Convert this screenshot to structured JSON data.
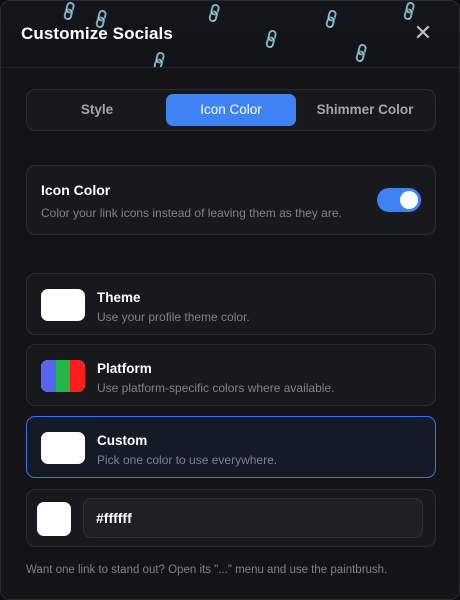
{
  "header": {
    "title": "Customize Socials",
    "close_glyph": "✕"
  },
  "tabs": [
    {
      "label": "Style"
    },
    {
      "label": "Icon Color"
    },
    {
      "label": "Shimmer Color"
    }
  ],
  "active_tab": "Icon Color",
  "icon_color_toggle": {
    "title": "Icon Color",
    "description": "Color your link icons instead of leaving them as they are.",
    "enabled": true
  },
  "options": [
    {
      "title": "Theme",
      "description": "Use your profile theme color.",
      "swatch": [
        "#ffffff"
      ]
    },
    {
      "title": "Platform",
      "description": "Use platform-specific colors where available.",
      "swatch": [
        "#5865f2",
        "#22b94a",
        "#ff1d1d"
      ]
    },
    {
      "title": "Custom",
      "description": "Pick one color to use everywhere.",
      "swatch": [
        "#ffffff"
      ]
    }
  ],
  "selected_option": "Custom",
  "custom_color": {
    "value": "#ffffff"
  },
  "footer": {
    "hint": "Want one link to stand out? Open its \"...\" menu and use the paintbrush."
  },
  "colors": {
    "accent": "#3f82f5",
    "background": "#141416",
    "card": "#18191c",
    "selected_border": "#3b76e0"
  }
}
